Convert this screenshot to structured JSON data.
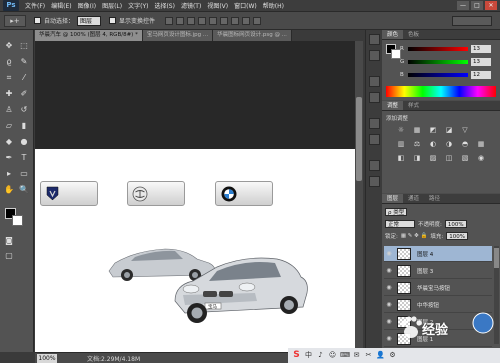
{
  "app": {
    "logo": "Ps",
    "menus": [
      "文件(F)",
      "编辑(E)",
      "图像(I)",
      "图层(L)",
      "文字(Y)",
      "选择(S)",
      "滤镜(T)",
      "视图(V)",
      "窗口(W)",
      "帮助(H)"
    ],
    "window_controls": [
      "—",
      "□",
      "✕"
    ]
  },
  "options_bar": {
    "tool_glyph": "▸+",
    "auto_select_label": "自动选择：",
    "auto_select_value": "图层",
    "show_transform_label": "显示变换控件"
  },
  "tabs": [
    {
      "label": "华晨汽车 @ 100% (图层 4, RGB/8#) *",
      "active": true
    },
    {
      "label": "宝马网页设计图标.jpg ...",
      "active": false
    },
    {
      "label": "华晨图标网页设计.psg @ ...",
      "active": false
    }
  ],
  "status": {
    "zoom": "100%",
    "doc": "文档:2.29M/4.18M"
  },
  "color_panel": {
    "tabs": [
      "颜色",
      "色板"
    ],
    "channels": [
      {
        "label": "R",
        "value": "13",
        "color": "#d53b3b"
      },
      {
        "label": "G",
        "value": "13",
        "color": "#3bb043"
      },
      {
        "label": "B",
        "value": "12",
        "color": "#3b5fd5"
      }
    ]
  },
  "adjust_panel": {
    "tabs": [
      "调整",
      "样式"
    ],
    "title": "添加调整",
    "icons": [
      "☼",
      "▦",
      "◩",
      "◪",
      "▽",
      "",
      "▥",
      "⚖",
      "◐",
      "◑",
      "◓",
      "▦",
      "◧",
      "◨",
      "▨",
      "◫",
      "▧",
      "◉"
    ]
  },
  "layers_panel": {
    "tabs": [
      "图层",
      "通道",
      "路径"
    ],
    "kind_label": "ρ 类型",
    "blend_mode": "正常",
    "opacity_label": "不透明度:",
    "opacity_value": "100%",
    "lock_label": "锁定:",
    "fill_label": "填充:",
    "fill_value": "100%",
    "layers": [
      {
        "name": "图层 4",
        "selected": true
      },
      {
        "name": "图层 3",
        "selected": false
      },
      {
        "name": "华晨宝马按钮",
        "selected": false
      },
      {
        "name": "中华按钮",
        "selected": false
      },
      {
        "name": "图层 2",
        "selected": false
      },
      {
        "name": "图层 1",
        "selected": false
      }
    ]
  },
  "car_badge": "宝马",
  "watermark": {
    "text": "经验"
  },
  "taskbar": [
    "S",
    "中",
    "♪",
    "☺",
    "⌨",
    "✉",
    "✂",
    "👤",
    "⚙"
  ]
}
